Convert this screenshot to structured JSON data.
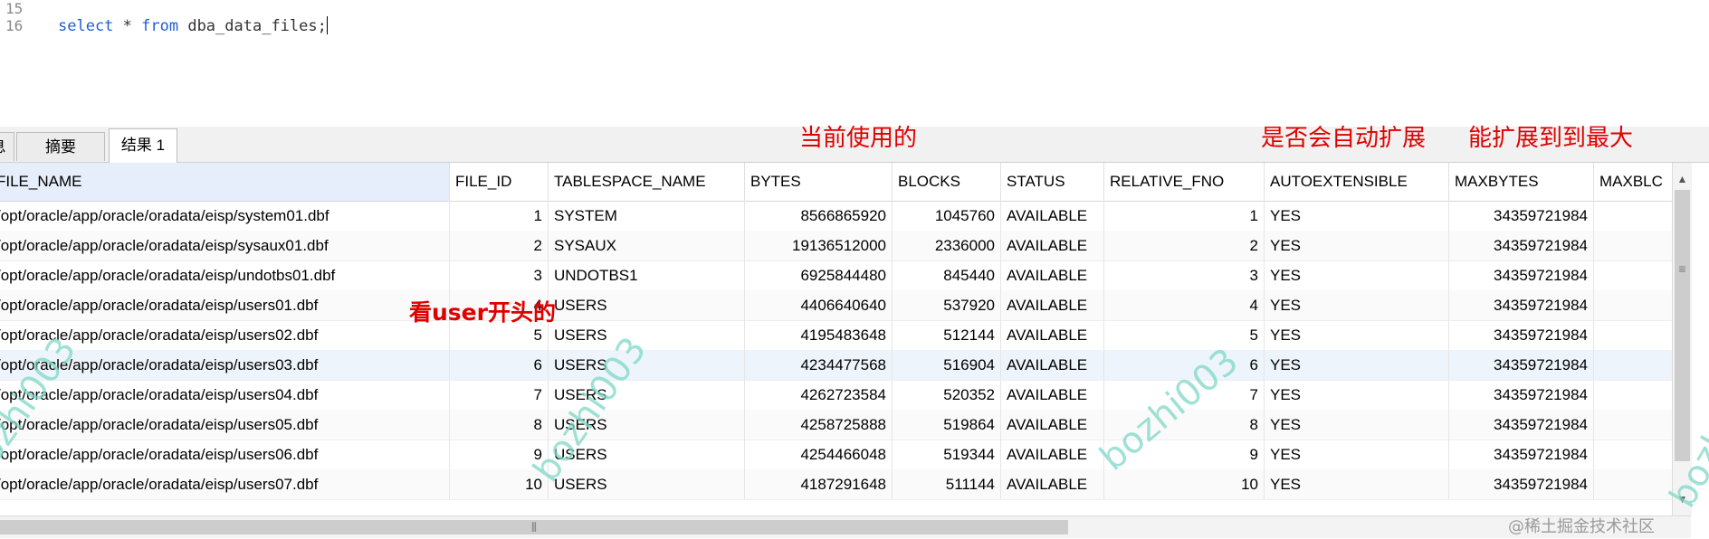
{
  "editor": {
    "line_numbers": [
      "15",
      "16"
    ],
    "sql_keyword1": "select",
    "sql_middle": " * ",
    "sql_keyword2": "from",
    "sql_rest": " dba_data_files;"
  },
  "tabs": [
    "息",
    "摘要",
    "结果 1"
  ],
  "columns": [
    "FILE_NAME",
    "FILE_ID",
    "TABLESPACE_NAME",
    "BYTES",
    "BLOCKS",
    "STATUS",
    "RELATIVE_FNO",
    "AUTOEXTENSIBLE",
    "MAXBYTES",
    "MAXBLC"
  ],
  "rows": [
    [
      "/opt/oracle/app/oracle/oradata/eisp/system01.dbf",
      "1",
      "SYSTEM",
      "8566865920",
      "1045760",
      "AVAILABLE",
      "1",
      "YES",
      "34359721984"
    ],
    [
      "/opt/oracle/app/oracle/oradata/eisp/sysaux01.dbf",
      "2",
      "SYSAUX",
      "19136512000",
      "2336000",
      "AVAILABLE",
      "2",
      "YES",
      "34359721984"
    ],
    [
      "/opt/oracle/app/oracle/oradata/eisp/undotbs01.dbf",
      "3",
      "UNDOTBS1",
      "6925844480",
      "845440",
      "AVAILABLE",
      "3",
      "YES",
      "34359721984"
    ],
    [
      "/opt/oracle/app/oracle/oradata/eisp/users01.dbf",
      "4",
      "USERS",
      "4406640640",
      "537920",
      "AVAILABLE",
      "4",
      "YES",
      "34359721984"
    ],
    [
      "/opt/oracle/app/oracle/oradata/eisp/users02.dbf",
      "5",
      "USERS",
      "4195483648",
      "512144",
      "AVAILABLE",
      "5",
      "YES",
      "34359721984"
    ],
    [
      "/opt/oracle/app/oracle/oradata/eisp/users03.dbf",
      "6",
      "USERS",
      "4234477568",
      "516904",
      "AVAILABLE",
      "6",
      "YES",
      "34359721984"
    ],
    [
      "/opt/oracle/app/oracle/oradata/eisp/users04.dbf",
      "7",
      "USERS",
      "4262723584",
      "520352",
      "AVAILABLE",
      "7",
      "YES",
      "34359721984"
    ],
    [
      "/opt/oracle/app/oracle/oradata/eisp/users05.dbf",
      "8",
      "USERS",
      "4258725888",
      "519864",
      "AVAILABLE",
      "8",
      "YES",
      "34359721984"
    ],
    [
      "/opt/oracle/app/oracle/oradata/eisp/users06.dbf",
      "9",
      "USERS",
      "4254466048",
      "519344",
      "AVAILABLE",
      "9",
      "YES",
      "34359721984"
    ],
    [
      "/opt/oracle/app/oracle/oradata/eisp/users07.dbf",
      "10",
      "USERS",
      "4187291648",
      "511144",
      "AVAILABLE",
      "10",
      "YES",
      "34359721984"
    ]
  ],
  "annotations": {
    "current_use": "当前使用的",
    "auto_extend": "是否会自动扩展",
    "max_extend": "能扩展到到最大",
    "look_user": "看user开头的"
  },
  "watermark": "bozhi003",
  "credit": "@稀土掘金技术社区",
  "icons": {
    "scroll_up": "arrow-up-icon",
    "scroll_down": "arrow-down-icon",
    "grip": "grip-icon"
  },
  "colors": {
    "annotation": "#e00000",
    "keyword": "#1f5fd6",
    "watermark": "#7fd8c7"
  }
}
